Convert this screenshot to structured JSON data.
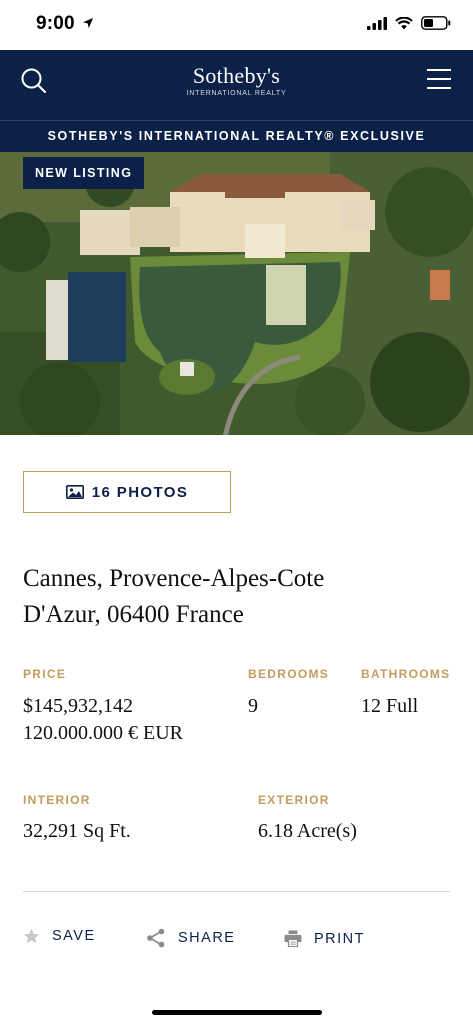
{
  "status_bar": {
    "time": "9:00"
  },
  "header": {
    "logo_main": "Sotheby's",
    "logo_sub": "INTERNATIONAL REALTY"
  },
  "banner": {
    "text": "SOTHEBY'S INTERNATIONAL REALTY® EXCLUSIVE"
  },
  "hero": {
    "badge": "NEW LISTING"
  },
  "photos_button": {
    "label": "16 PHOTOS"
  },
  "listing": {
    "address_line1": "Cannes, Provence-Alpes-Cote",
    "address_line2": "D'Azur, 06400 France",
    "price_label": "PRICE",
    "price_usd": "$145,932,142",
    "price_eur": "120.000.000 € EUR",
    "bedrooms_label": "BEDROOMS",
    "bedrooms_value": "9",
    "bathrooms_label": "BATHROOMS",
    "bathrooms_value": "12 Full",
    "interior_label": "INTERIOR",
    "interior_value": "32,291 Sq Ft.",
    "exterior_label": "EXTERIOR",
    "exterior_value": "6.18 Acre(s)"
  },
  "actions": {
    "save": "SAVE",
    "share": "SHARE",
    "print": "PRINT"
  },
  "colors": {
    "navy": "#0b2148",
    "gold": "#c39d5c"
  }
}
